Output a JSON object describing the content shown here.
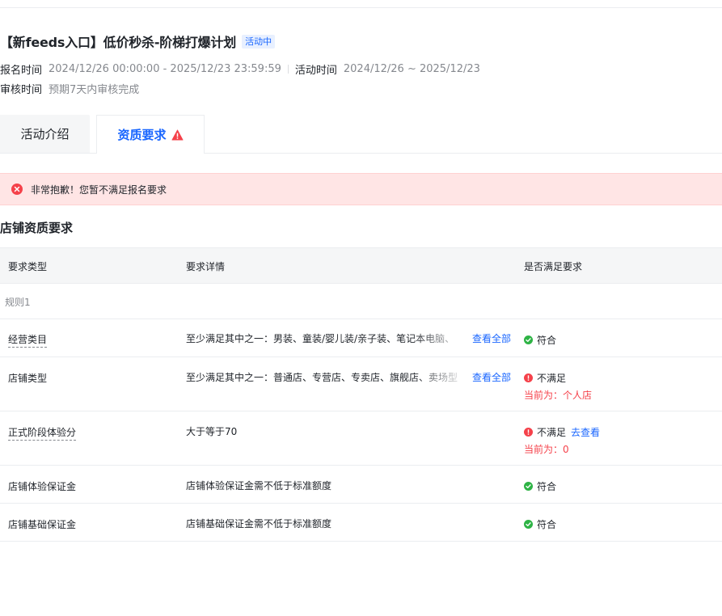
{
  "activity": {
    "title": "【新feeds入口】低价秒杀-阶梯打爆计划",
    "status": "活动中",
    "signup_label": "报名时间",
    "signup_value": "2024/12/26 00:00:00 - 2025/12/23 23:59:59",
    "activity_label": "活动时间",
    "activity_value": "2024/12/26 ~ 2025/12/23",
    "review_label": "审核时间",
    "review_value": "预期7天内审核完成"
  },
  "tabs": {
    "intro": "活动介绍",
    "requirements": "资质要求"
  },
  "alert": {
    "message": "非常抱歉！您暂不满足报名要求"
  },
  "section": {
    "title": "店铺资质要求"
  },
  "table": {
    "headers": [
      "要求类型",
      "要求详情",
      "是否满足要求"
    ],
    "rule_label": "规则1",
    "rows": [
      {
        "type": "经营类目",
        "detail": "至少满足其中之一：男装、童装/婴儿装/亲子装、笔记本电脑、",
        "view_all": "查看全部",
        "status": "符合"
      },
      {
        "type": "店铺类型",
        "detail": "至少满足其中之一：普通店、专营店、专卖店、旗舰店、卖场型",
        "view_all": "查看全部",
        "status": "不满足",
        "current": "当前为：个人店"
      },
      {
        "type": "正式阶段体验分",
        "detail": "大于等于70",
        "status": "不满足",
        "link": "去查看",
        "current": "当前为：0"
      },
      {
        "type": "店铺体验保证金",
        "detail": "店铺体验保证金需不低于标准额度",
        "status": "符合"
      },
      {
        "type": "店铺基础保证金",
        "detail": "店铺基础保证金需不低于标准额度",
        "status": "符合"
      }
    ]
  },
  "colors": {
    "accent": "#1966ff",
    "error": "#f5414a",
    "success": "#2eb345",
    "alert_bg": "#ffe5e5"
  },
  "icons": {
    "tab_warning": "warning-triangle-icon",
    "alert": "error-circle-icon",
    "ok": "check-circle-icon",
    "bad": "exclamation-circle-icon"
  }
}
